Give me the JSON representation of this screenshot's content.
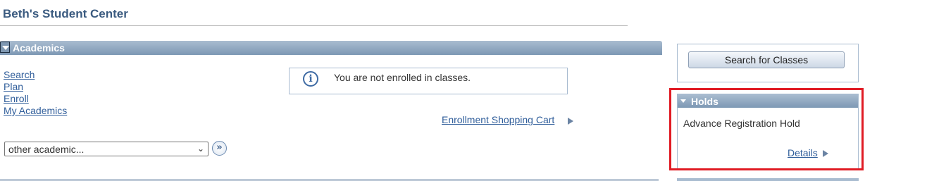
{
  "page": {
    "title": "Beth's Student Center"
  },
  "academics": {
    "header": "Academics",
    "links": [
      "Search",
      "Plan",
      "Enroll",
      "My Academics"
    ],
    "notice": "You are not enrolled in classes.",
    "cart_link": "Enrollment Shopping Cart",
    "select": {
      "value": "other academic..."
    }
  },
  "search_panel": {
    "button": "Search for Classes"
  },
  "holds": {
    "header": "Holds",
    "item": "Advance Registration Hold",
    "details": "Details"
  },
  "colors": {
    "header_bg": "#7d98b4",
    "link": "#2f5d9a",
    "title": "#3b5b80",
    "highlight": "#e01b24"
  }
}
